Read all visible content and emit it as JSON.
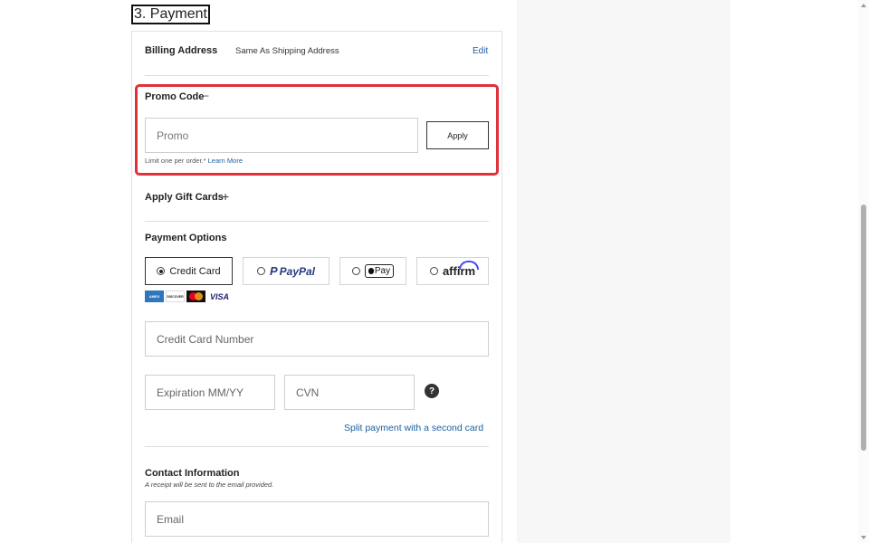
{
  "section": {
    "title": "3. Payment"
  },
  "billing": {
    "label": "Billing Address",
    "value": "Same As Shipping Address",
    "edit_label": "Edit"
  },
  "promo": {
    "label": "Promo Code",
    "toggle_symbol": "−",
    "placeholder": "Promo",
    "apply_label": "Apply",
    "note": "Limit one per order.*",
    "learn_more": "Learn More",
    "highlight_color": "#e0303a"
  },
  "gift_cards": {
    "label": "Apply Gift Cards",
    "toggle_symbol": "+"
  },
  "payment_options": {
    "label": "Payment Options",
    "selected": "Credit Card",
    "options": [
      {
        "id": "credit-card",
        "label": "Credit Card",
        "checked": true
      },
      {
        "id": "paypal",
        "label": "PayPal",
        "checked": false
      },
      {
        "id": "apple-pay",
        "label": "Pay",
        "checked": false
      },
      {
        "id": "affirm",
        "label": "affirm",
        "checked": false
      }
    ],
    "card_logos": [
      "AMEX",
      "DISCOVER",
      "mastercard",
      "VISA"
    ]
  },
  "card_form": {
    "number_placeholder": "Credit Card Number",
    "expiration_placeholder": "Expiration MM/YY",
    "cvn_placeholder": "CVN",
    "help_symbol": "?",
    "split_link": "Split payment with a second card"
  },
  "contact": {
    "label": "Contact Information",
    "note": "A receipt will be sent to the email provided.",
    "email_placeholder": "Email"
  },
  "colors": {
    "link": "#1a5f9e",
    "highlight": "#e0303a",
    "side_panel": "#f7f7f7"
  }
}
